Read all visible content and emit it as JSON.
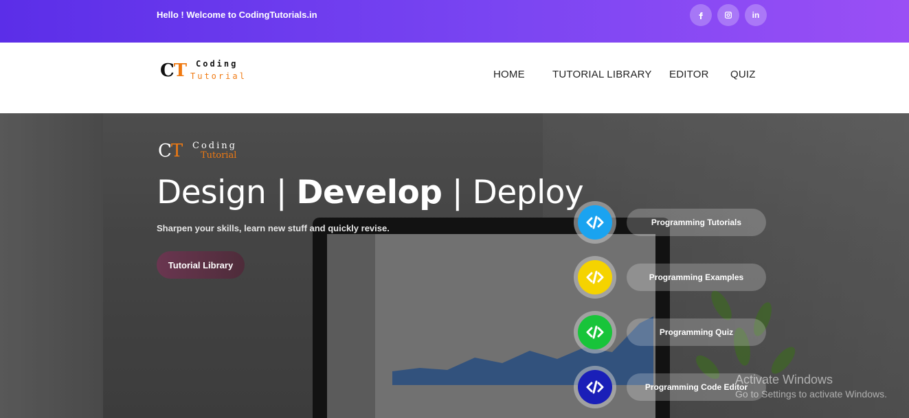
{
  "topbar": {
    "welcome": "Hello ! Welcome to CodingTutorials.in",
    "social": [
      {
        "icon": "facebook-icon",
        "glyph": "f"
      },
      {
        "icon": "instagram-icon",
        "glyph": ""
      },
      {
        "icon": "linkedin-icon",
        "glyph": "in"
      }
    ]
  },
  "logo": {
    "ct_c": "C",
    "ct_t": "T",
    "word1": "Coding",
    "word2": "Tutorial"
  },
  "nav": {
    "home": "HOME",
    "library": "TUTORIAL LIBRARY",
    "editor": "EDITOR",
    "quiz": "QUIZ"
  },
  "hero": {
    "logo": {
      "ct_c": "C",
      "ct_t": "T",
      "word1": "Coding",
      "word2": "Tutorial"
    },
    "headline_a": "Design | ",
    "headline_b": "Develop",
    "headline_c": " | Deploy",
    "tagline": "Sharpen your skills, learn new stuff and quickly revise.",
    "cta": "Tutorial Library",
    "features": [
      {
        "label": "Programming Tutorials",
        "color": "#1aa3f0"
      },
      {
        "label": "Programming Examples",
        "color": "#f5d300"
      },
      {
        "label": "Programming Quiz",
        "color": "#18c43a"
      },
      {
        "label": "Programming Code Editor",
        "color": "#1a1fb8"
      }
    ]
  },
  "watermark": {
    "line1": "Activate Windows",
    "line2": "Go to Settings to activate Windows."
  },
  "colors": {
    "accent": "#7a45f2",
    "orange": "#f07a12"
  }
}
